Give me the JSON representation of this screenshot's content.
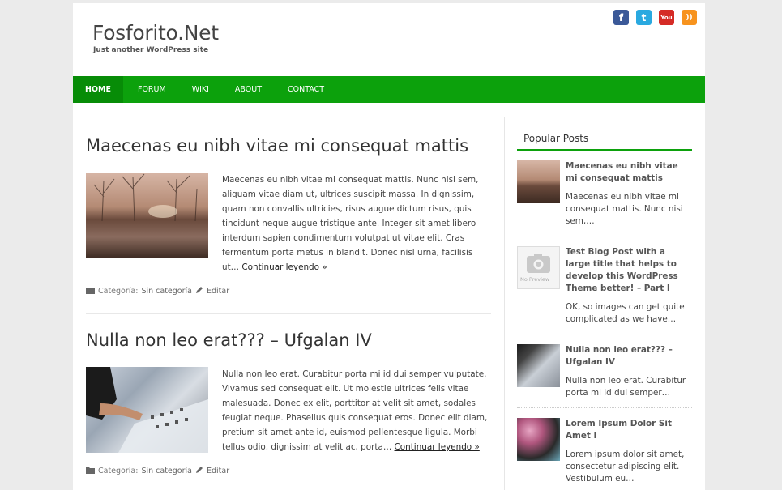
{
  "header": {
    "site_title": "Fosforito.Net",
    "tagline": "Just another WordPress site",
    "social": [
      {
        "name": "facebook-icon",
        "glyph": "f",
        "color": "#3b5998"
      },
      {
        "name": "twitter-icon",
        "glyph": "t",
        "color": "#2aa9e0"
      },
      {
        "name": "youtube-icon",
        "glyph": "You",
        "color": "#d52b26"
      },
      {
        "name": "rss-icon",
        "glyph": "))",
        "color": "#f7931e"
      }
    ]
  },
  "nav": {
    "items": [
      "Home",
      "Forum",
      "Wiki",
      "About",
      "Contact"
    ],
    "accent": "#0ca10c"
  },
  "posts": [
    {
      "title": "Maecenas eu nibh vitae mi consequat mattis",
      "excerpt": "Maecenas eu nibh vitae mi consequat mattis. Nunc nisi sem, aliquam vitae diam ut, ultrices suscipit massa. In dignissim, quam non convallis ultricies, risus augue dictum risus, quis tincidunt neque augue tristique ante. Integer sit amet libero interdum sapien condimentum volutpat ut vitae elit. Cras fermentum porta metus in blandit. Donec nisl urna, facilisis ut…",
      "more": "Continuar leyendo »",
      "category_label": "Categoría:",
      "category": "Sin categoría",
      "edit": "Editar"
    },
    {
      "title": "Nulla non leo erat??? – Ufgalan IV",
      "excerpt": "Nulla non leo erat. Curabitur porta mi id dui semper vulputate. Vivamus sed consequat elit. Ut molestie ultrices felis vitae malesuada. Donec ex elit, porttitor at velit sit amet, sodales feugiat neque. Phasellus quis consequat eros. Donec elit diam, pretium sit amet ante id, euismod pellentesque ligula. Morbi tellus odio, dignissim at velit ac, porta…",
      "more": "Continuar leyendo »",
      "category_label": "Categoría:",
      "category": "Sin categoría",
      "edit": "Editar"
    }
  ],
  "sidebar": {
    "widget_title": "Popular Posts",
    "items": [
      {
        "title": "Maecenas eu nibh vitae mi consequat mattis",
        "excerpt": "Maecenas eu nibh vitae mi consequat mattis. Nunc nisi sem,…"
      },
      {
        "title": "Test Blog Post with a large title that helps to develop this WordPress Theme better! – Part I",
        "excerpt": "OK, so images can get quite complicated as we have…",
        "no_preview": "No Preview"
      },
      {
        "title": "Nulla non leo erat??? – Ufgalan IV",
        "excerpt": "Nulla non leo erat. Curabitur porta mi id dui semper…"
      },
      {
        "title": "Lorem Ipsum Dolor Sit Amet I",
        "excerpt": "Lorem ipsum dolor sit amet, consectetur adipiscing elit. Vestibulum eu…"
      }
    ]
  }
}
